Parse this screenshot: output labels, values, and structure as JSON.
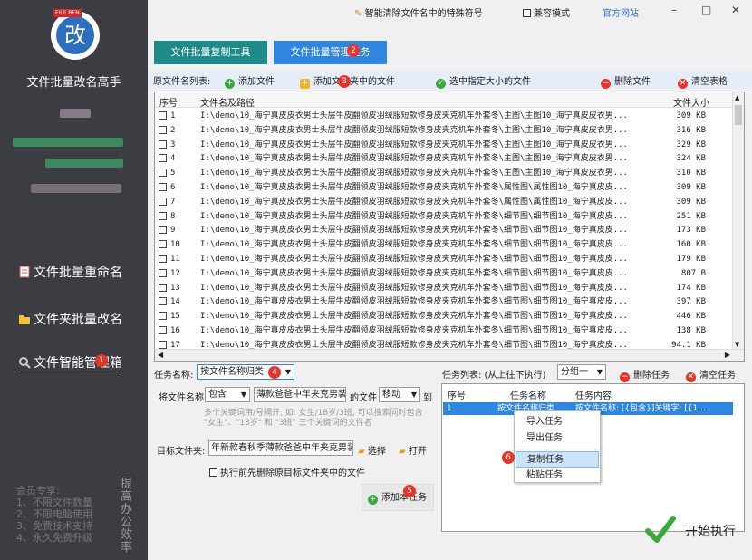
{
  "app": {
    "logo_text": "改",
    "logo_tag": "FILE REN",
    "title": "文件批量改名高手"
  },
  "nav": [
    {
      "label": "文件批量重命名",
      "icon": "document-icon"
    },
    {
      "label": "文件夹批量改名",
      "icon": "folder-icon"
    },
    {
      "label": "文件智能管理箱",
      "icon": "magnifier-icon",
      "active": true
    }
  ],
  "member": {
    "heading": "会员专享:",
    "lines": [
      "1、不限文件数量",
      "2、不限电脑使用",
      "3、免费技术支持",
      "4、永久免费升级"
    ],
    "side": "提高办公效率"
  },
  "topbar": {
    "clean": "智能清除文件名中的特殊符号",
    "compat": "兼容模式",
    "site": "官方网站",
    "min": "–",
    "max": "□",
    "close": "✕"
  },
  "tabs": [
    {
      "label": "文件批量复制工具"
    },
    {
      "label": "文件批量管理任务"
    }
  ],
  "toolbar": {
    "list_label": "原文件名列表:",
    "add_file": "添加文件",
    "add_folder": "添加文件夹中的文件",
    "select_size": "选中指定大小的文件",
    "delete_file": "删除文件",
    "clear_table": "清空表格"
  },
  "grid": {
    "headers": {
      "num": "序号",
      "path": "文件名及路径",
      "size": "文件大小"
    },
    "rows": [
      {
        "n": "1",
        "p": "I:\\demo\\10_海宁真皮皮衣男士头层牛皮翻领皮羽绒服短款修身皮夹克机车外套冬\\主图\\主图10_海宁真皮皮衣男...",
        "s": "309 KB"
      },
      {
        "n": "2",
        "p": "I:\\demo\\10_海宁真皮皮衣男士头层牛皮翻领皮羽绒服短款修身皮夹克机车外套冬\\主图\\主图10_海宁真皮皮衣男...",
        "s": "316 KB"
      },
      {
        "n": "3",
        "p": "I:\\demo\\10_海宁真皮皮衣男士头层牛皮翻领皮羽绒服短款修身皮夹克机车外套冬\\主图\\主图10_海宁真皮皮衣男...",
        "s": "329 KB"
      },
      {
        "n": "4",
        "p": "I:\\demo\\10_海宁真皮皮衣男士头层牛皮翻领皮羽绒服短款修身皮夹克机车外套冬\\主图\\主图10_海宁真皮皮衣男...",
        "s": "324 KB"
      },
      {
        "n": "5",
        "p": "I:\\demo\\10_海宁真皮皮衣男士头层牛皮翻领皮羽绒服短款修身皮夹克机车外套冬\\主图\\主图10_海宁真皮皮衣男...",
        "s": "310 KB"
      },
      {
        "n": "6",
        "p": "I:\\demo\\10_海宁真皮皮衣男士头层牛皮翻领皮羽绒服短款修身皮夹克机车外套冬\\属性图\\属性图10_海宁真皮皮...",
        "s": "309 KB"
      },
      {
        "n": "7",
        "p": "I:\\demo\\10_海宁真皮皮衣男士头层牛皮翻领皮羽绒服短款修身皮夹克机车外套冬\\属性图\\属性图10_海宁真皮皮...",
        "s": "309 KB"
      },
      {
        "n": "8",
        "p": "I:\\demo\\10_海宁真皮皮衣男士头层牛皮翻领皮羽绒服短款修身皮夹克机车外套冬\\细节图\\细节图10_海宁真皮皮...",
        "s": "251 KB"
      },
      {
        "n": "9",
        "p": "I:\\demo\\10_海宁真皮皮衣男士头层牛皮翻领皮羽绒服短款修身皮夹克机车外套冬\\细节图\\细节图10_海宁真皮皮...",
        "s": "173 KB"
      },
      {
        "n": "10",
        "p": "I:\\demo\\10_海宁真皮皮衣男士头层牛皮翻领皮羽绒服短款修身皮夹克机车外套冬\\细节图\\细节图10_海宁真皮皮...",
        "s": "160 KB"
      },
      {
        "n": "11",
        "p": "I:\\demo\\10_海宁真皮皮衣男士头层牛皮翻领皮羽绒服短款修身皮夹克机车外套冬\\细节图\\细节图10_海宁真皮皮...",
        "s": "179 KB"
      },
      {
        "n": "12",
        "p": "I:\\demo\\10_海宁真皮皮衣男士头层牛皮翻领皮羽绒服短款修身皮夹克机车外套冬\\细节图\\细节图10_海宁真皮皮...",
        "s": "807 B"
      },
      {
        "n": "13",
        "p": "I:\\demo\\10_海宁真皮皮衣男士头层牛皮翻领皮羽绒服短款修身皮夹克机车外套冬\\细节图\\细节图10_海宁真皮皮...",
        "s": "174 KB"
      },
      {
        "n": "14",
        "p": "I:\\demo\\10_海宁真皮皮衣男士头层牛皮翻领皮羽绒服短款修身皮夹克机车外套冬\\细节图\\细节图10_海宁真皮皮...",
        "s": "397 KB"
      },
      {
        "n": "15",
        "p": "I:\\demo\\10_海宁真皮皮衣男士头层牛皮翻领皮羽绒服短款修身皮夹克机车外套冬\\细节图\\细节图10_海宁真皮皮...",
        "s": "446 KB"
      },
      {
        "n": "16",
        "p": "I:\\demo\\10_海宁真皮皮衣男士头层牛皮翻领皮羽绒服短款修身皮夹克机车外套冬\\细节图\\细节图10_海宁真皮皮...",
        "s": "138 KB"
      },
      {
        "n": "17",
        "p": "I:\\demo\\10_海宁真皮皮衣男士头层牛皮翻领皮羽绒服短款修身皮夹克机车外套冬\\细节图\\细节图10_海宁真皮皮...",
        "s": "94.1 KB"
      }
    ]
  },
  "form": {
    "task_name_label": "任务名称:",
    "task_name_value": "按文件名称归类",
    "rule_prefix": "将文件名称",
    "match_mode": "包含",
    "keyword": "薄款爸爸中年夹克男装",
    "rule_middle": "的文件",
    "action": "移动",
    "rule_suffix": "到",
    "hint": "多个关键词用/号隔开, 如: 女生/18岁/3班, 可以搜索同时包含 \"女生\"、\"18岁\" 和 \"3班\" 三个关键词的文件名",
    "target_label": "目标文件夹:",
    "target_value": "年新款春秋季薄款爸爸中年夹克男装",
    "choose": "选择",
    "open": "打开",
    "delete_check": "执行前先删除原目标文件夹中的文件",
    "add_task": "添加本任务"
  },
  "tasks": {
    "label": "任务列表: (从上往下执行)",
    "group": "分组一",
    "delete_task": "删除任务",
    "clear_task": "清空任务",
    "headers": {
      "num": "序号",
      "name": "任务名称",
      "content": "任务内容"
    },
    "rows": [
      {
        "n": "1",
        "name": "按文件名称归类",
        "content": "按文件名称: [{包含}]关键字: [{1..."
      }
    ]
  },
  "context_menu": {
    "items": [
      "导入任务",
      "导出任务",
      "复制任务",
      "粘贴任务"
    ]
  },
  "run": {
    "label": "开始执行"
  },
  "badges": [
    "1",
    "2",
    "3",
    "4",
    "5",
    "6"
  ],
  "colors": {
    "sidebar": "#3c3d42",
    "tab_teal": "#1e8a8a",
    "tab_blue": "#2e86e0",
    "accent_red": "#e8352b",
    "green_ok": "#3aa83a",
    "selection": "#2e86e0"
  }
}
